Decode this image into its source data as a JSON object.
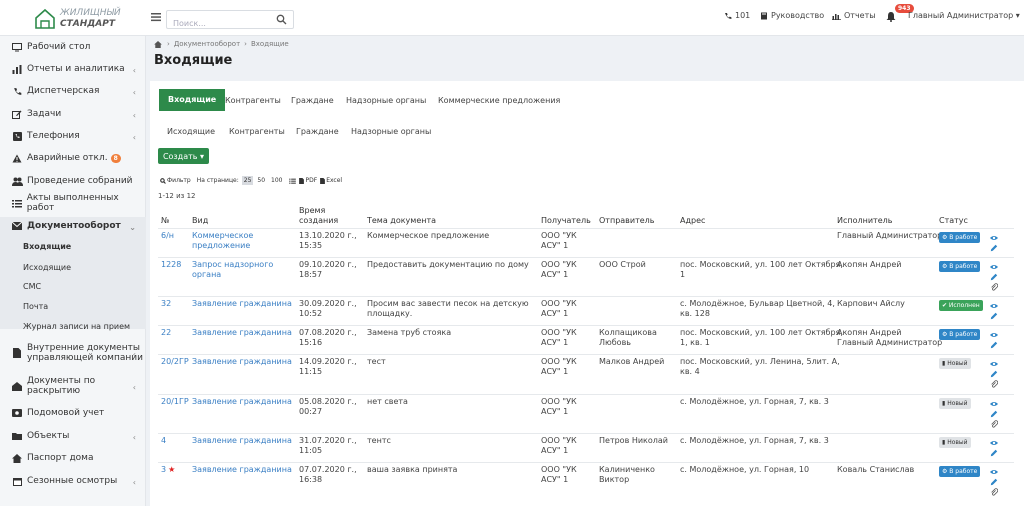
{
  "brand": {
    "line1": "ЖИЛИЩНЫЙ",
    "line2": "СТАНДАРТ",
    "accent": "#2d8a4a"
  },
  "search": {
    "placeholder": "Поиск..."
  },
  "topbar": {
    "phone": "101",
    "guide": "Руководство",
    "reports": "Отчеты",
    "notif_count": "943",
    "user": "Главный Администратор ▾"
  },
  "sidebar": {
    "items": [
      {
        "label": "Рабочий стол",
        "icon": "monitor-icon",
        "chevron": false
      },
      {
        "label": "Отчеты и аналитика",
        "icon": "bar-chart-icon",
        "chevron": true
      },
      {
        "label": "Диспетчерская",
        "icon": "phone-icon",
        "chevron": true
      },
      {
        "label": "Задачи",
        "icon": "edit-icon",
        "chevron": true
      },
      {
        "label": "Телефония",
        "icon": "phone-box-icon",
        "chevron": true
      },
      {
        "label": "Аварийные откл.",
        "icon": "warning-icon",
        "chevron": false,
        "badge": "8"
      },
      {
        "label": "Проведение собраний",
        "icon": "users-icon",
        "chevron": false
      },
      {
        "label": "Акты выполненных работ",
        "icon": "list-icon",
        "chevron": false
      },
      {
        "label": "Документооборот",
        "icon": "envelope-icon",
        "chevron": true
      },
      {
        "label": "Внутренние документы управляющей компании",
        "l1": "Внутренние документы",
        "l2": "управляющей компании",
        "icon": "doc-icon",
        "chevron": true
      },
      {
        "label": "Документы по раскрытию",
        "l1": "Документы по",
        "l2": "раскрытию",
        "icon": "building-icon",
        "chevron": true
      },
      {
        "label": "Подомовой учет",
        "icon": "card-icon",
        "chevron": false
      },
      {
        "label": "Объекты",
        "icon": "folder-icon",
        "chevron": true
      },
      {
        "label": "Паспорт дома",
        "icon": "home-icon",
        "chevron": false
      },
      {
        "label": "Сезонные осмотры",
        "icon": "calendar-icon",
        "chevron": true
      }
    ],
    "sub": [
      "Входящие",
      "Исходящие",
      "СМС",
      "Почта",
      "Журнал записи на прием"
    ]
  },
  "breadcrumb": {
    "b1": "Документооборот",
    "b2": "Входящие"
  },
  "page": {
    "title": "Входящие"
  },
  "tabs1": [
    "Входящие",
    "Контрагенты",
    "Граждане",
    "Надзорные органы",
    "Коммерческие предложения"
  ],
  "tabs2": [
    "Исходящие",
    "Контрагенты",
    "Граждане",
    "Надзорные органы"
  ],
  "create_label": "Создать ▾",
  "toolbar": {
    "filter": "Фильтр",
    "per_page": "На странице:",
    "pages": [
      "25",
      "50",
      "100"
    ],
    "pdf": "PDF",
    "excel": "Excel"
  },
  "count": "1-12 из 12",
  "columns": {
    "num": "№",
    "type": "Вид",
    "time1": "Время",
    "time2": "создания",
    "subject": "Тема документа",
    "recipient": "Получатель",
    "sender": "Отправитель",
    "address": "Адрес",
    "executor": "Исполнитель",
    "status": "Статус"
  },
  "rows": [
    {
      "num": "6/н",
      "type": [
        "Коммерческое",
        "предложение"
      ],
      "time": [
        "13.10.2020 г.,",
        "15:35"
      ],
      "subject": [
        "Коммерческое предложение"
      ],
      "recipient": [
        "ООО \"УК",
        "АСУ\" 1"
      ],
      "sender": [],
      "address": [],
      "executor": [
        "Главный Администратор"
      ],
      "status": "В работе",
      "status_kind": "blue"
    },
    {
      "num": "1228",
      "type": [
        "Запрос надзорного",
        "органа"
      ],
      "time": [
        "09.10.2020 г.,",
        "18:57"
      ],
      "subject": [
        "Предоставить документацию по дому"
      ],
      "recipient": [
        "ООО \"УК",
        "АСУ\" 1"
      ],
      "sender": [
        "ООО Строй"
      ],
      "address": [
        "пос. Московский, ул. 100 лет Октября,",
        "1"
      ],
      "executor": [
        "Акопян Андрей"
      ],
      "status": "В работе",
      "status_kind": "blue"
    },
    {
      "num": "32",
      "type": [
        "Заявление гражданина"
      ],
      "time": [
        "30.09.2020 г.,",
        "10:52"
      ],
      "subject": [
        "Просим вас завести песок на детскую",
        "площадку."
      ],
      "recipient": [
        "ООО \"УК",
        "АСУ\" 1"
      ],
      "sender": [],
      "address": [
        "с. Молодёжное, Бульвар Цветной, 4,",
        "кв. 128"
      ],
      "executor": [
        "Карпович Айслу"
      ],
      "status": "Исполнен",
      "status_kind": "green"
    },
    {
      "num": "22",
      "type": [
        "Заявление гражданина"
      ],
      "time": [
        "07.08.2020 г.,",
        "15:16"
      ],
      "subject": [
        "Замена труб стояка"
      ],
      "recipient": [
        "ООО \"УК",
        "АСУ\" 1"
      ],
      "sender": [
        "Колпащикова",
        "Любовь"
      ],
      "address": [
        "пос. Московский, ул. 100 лет Октября,",
        "1, кв. 1"
      ],
      "executor": [
        "Акопян Андрей",
        "Главный Администратор"
      ],
      "status": "В работе",
      "status_kind": "blue"
    },
    {
      "num": "20/2ГР",
      "type": [
        "Заявление гражданина"
      ],
      "time": [
        "14.09.2020 г.,",
        "11:15"
      ],
      "subject": [
        "тест"
      ],
      "recipient": [
        "ООО \"УК",
        "АСУ\" 1"
      ],
      "sender": [
        "Малков Андрей"
      ],
      "address": [
        "пос. Московский, ул. Ленина, 5лит. А,",
        "кв. 4"
      ],
      "executor": [],
      "status": "Новый",
      "status_kind": "grey"
    },
    {
      "num": "20/1ГР",
      "type": [
        "Заявление гражданина"
      ],
      "time": [
        "05.08.2020 г.,",
        "00:27"
      ],
      "subject": [
        "нет света"
      ],
      "recipient": [
        "ООО \"УК",
        "АСУ\" 1"
      ],
      "sender": [],
      "address": [
        "с. Молодёжное, ул. Горная, 7, кв. 3"
      ],
      "executor": [],
      "status": "Новый",
      "status_kind": "grey"
    },
    {
      "num": "4",
      "type": [
        "Заявление гражданина"
      ],
      "time": [
        "31.07.2020 г.,",
        "11:05"
      ],
      "subject": [
        "тентс"
      ],
      "recipient": [
        "ООО \"УК",
        "АСУ\" 1"
      ],
      "sender": [
        "Петров Николай"
      ],
      "address": [
        "с. Молодёжное, ул. Горная, 7, кв. 3"
      ],
      "executor": [],
      "status": "Новый",
      "status_kind": "grey"
    },
    {
      "num": "3",
      "type": [
        "Заявление гражданина"
      ],
      "time": [
        "07.07.2020 г.,",
        "16:38"
      ],
      "subject": [
        "ваша заявка принята"
      ],
      "recipient": [
        "ООО \"УК",
        "АСУ\" 1"
      ],
      "sender": [
        "Калиниченко",
        "Виктор"
      ],
      "address": [
        "с. Молодёжное, ул. Горная, 10"
      ],
      "executor": [
        "Коваль Станислав"
      ],
      "status": "В работе",
      "status_kind": "blue",
      "starred": true
    }
  ]
}
